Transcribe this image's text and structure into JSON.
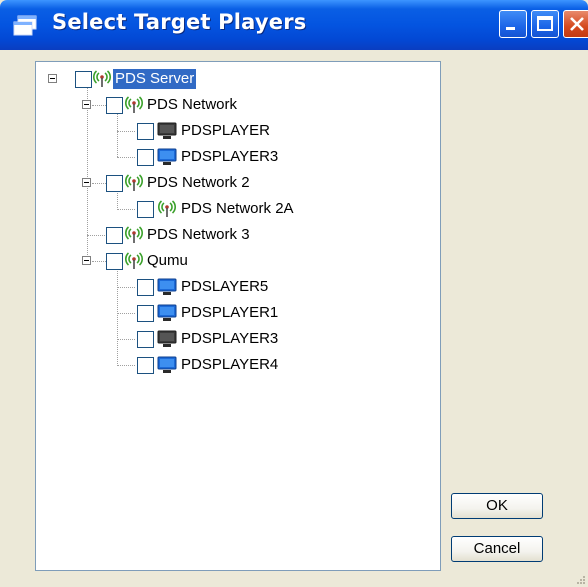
{
  "window": {
    "title": "Select Target Players"
  },
  "tree": {
    "items": [
      {
        "label": "PDS Server",
        "icon": "antenna-icon",
        "selected": true,
        "checked": false
      },
      {
        "label": "PDS Network",
        "icon": "antenna-icon",
        "checked": false
      },
      {
        "label": "PDSPLAYER",
        "icon": "monitor-offline-icon",
        "checked": false
      },
      {
        "label": "PDSPLAYER3",
        "icon": "monitor-online-icon",
        "checked": false
      },
      {
        "label": "PDS Network 2",
        "icon": "antenna-icon",
        "checked": false
      },
      {
        "label": "PDS Network 2A",
        "icon": "antenna-icon",
        "checked": false
      },
      {
        "label": "PDS Network 3",
        "icon": "antenna-icon",
        "checked": false
      },
      {
        "label": "Qumu",
        "icon": "antenna-icon",
        "checked": false
      },
      {
        "label": "PDSLAYER5",
        "icon": "monitor-online-icon",
        "checked": false
      },
      {
        "label": "PDSPLAYER1",
        "icon": "monitor-online-icon",
        "checked": false
      },
      {
        "label": "PDSPLAYER3",
        "icon": "monitor-offline-icon",
        "checked": false
      },
      {
        "label": "PDSPLAYER4",
        "icon": "monitor-online-icon",
        "checked": false
      }
    ]
  },
  "buttons": {
    "ok": "OK",
    "cancel": "Cancel"
  },
  "colors": {
    "titlebar": "#0454e0",
    "selection": "#316ac5",
    "antenna": "#3aa02a",
    "monitor_online": "#1c6ad8",
    "monitor_offline": "#4a4a4a"
  }
}
